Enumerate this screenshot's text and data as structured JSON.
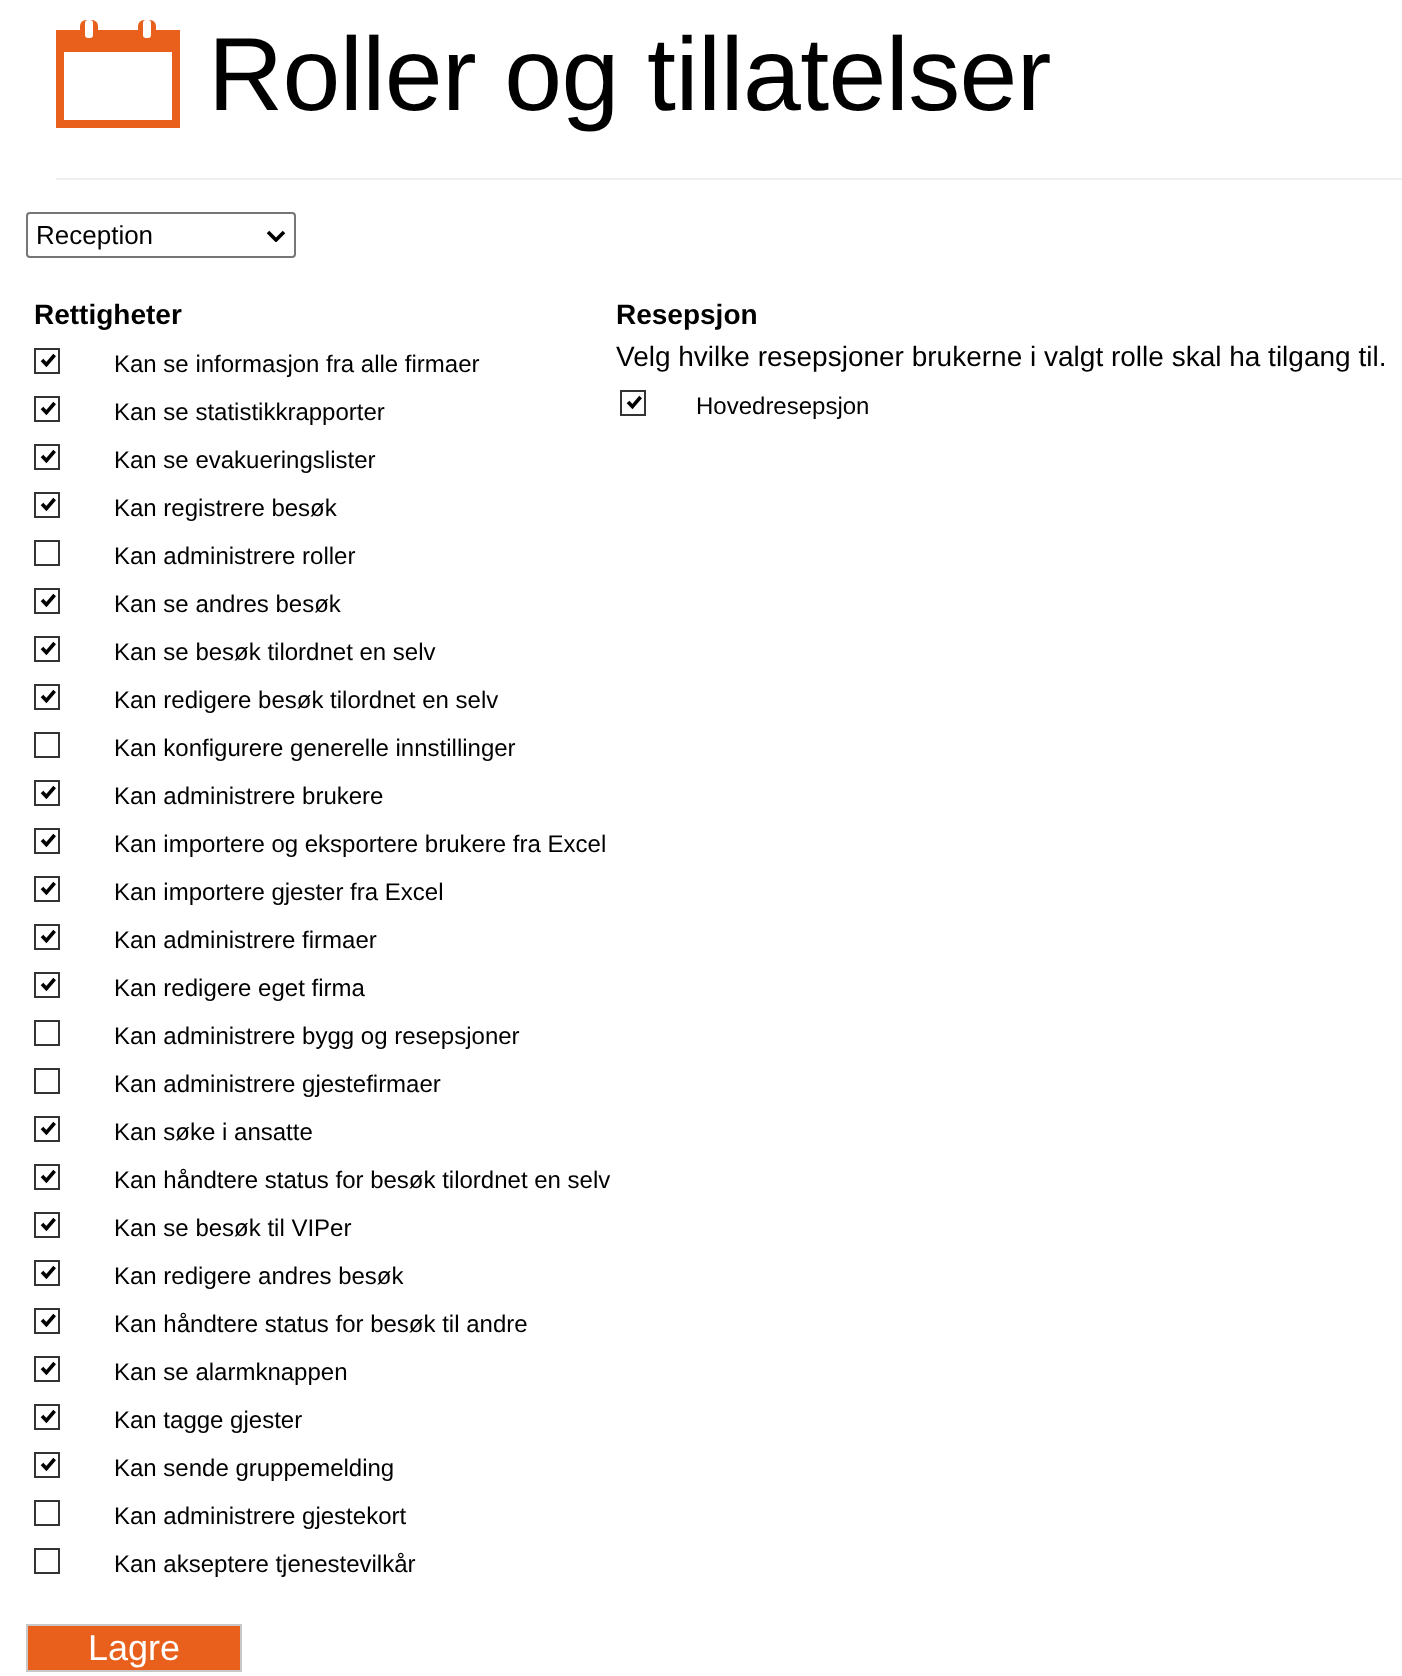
{
  "header": {
    "title": "Roller og tillatelser"
  },
  "role_select": {
    "value": "Reception"
  },
  "permissions": {
    "heading": "Rettigheter",
    "items": [
      {
        "label": "Kan se informasjon fra alle firmaer",
        "checked": true
      },
      {
        "label": "Kan se statistikkrapporter",
        "checked": true
      },
      {
        "label": "Kan se evakueringslister",
        "checked": true
      },
      {
        "label": "Kan registrere besøk",
        "checked": true
      },
      {
        "label": "Kan administrere roller",
        "checked": false
      },
      {
        "label": "Kan se andres besøk",
        "checked": true
      },
      {
        "label": "Kan se besøk tilordnet en selv",
        "checked": true
      },
      {
        "label": "Kan redigere besøk tilordnet en selv",
        "checked": true
      },
      {
        "label": "Kan konfigurere generelle innstillinger",
        "checked": false
      },
      {
        "label": "Kan administrere brukere",
        "checked": true
      },
      {
        "label": "Kan importere og eksportere brukere fra Excel",
        "checked": true
      },
      {
        "label": "Kan importere gjester fra Excel",
        "checked": true
      },
      {
        "label": "Kan administrere firmaer",
        "checked": true
      },
      {
        "label": "Kan redigere eget firma",
        "checked": true
      },
      {
        "label": "Kan administrere bygg og resepsjoner",
        "checked": false
      },
      {
        "label": "Kan administrere gjestefirmaer",
        "checked": false
      },
      {
        "label": "Kan søke i ansatte",
        "checked": true
      },
      {
        "label": "Kan håndtere status for besøk tilordnet en selv",
        "checked": true
      },
      {
        "label": "Kan se besøk til VIPer",
        "checked": true
      },
      {
        "label": "Kan redigere andres besøk",
        "checked": true
      },
      {
        "label": "Kan håndtere status for besøk til andre",
        "checked": true
      },
      {
        "label": "Kan se alarmknappen",
        "checked": true
      },
      {
        "label": "Kan tagge gjester",
        "checked": true
      },
      {
        "label": "Kan sende gruppemelding",
        "checked": true
      },
      {
        "label": "Kan administrere gjestekort",
        "checked": false
      },
      {
        "label": "Kan akseptere tjenestevilkår",
        "checked": false
      }
    ]
  },
  "receptions": {
    "heading": "Resepsjon",
    "description": "Velg hvilke resepsjoner brukerne i valgt rolle skal ha tilgang til.",
    "items": [
      {
        "label": "Hovedresepsjon",
        "checked": true
      }
    ]
  },
  "save_button": {
    "label": "Lagre"
  }
}
